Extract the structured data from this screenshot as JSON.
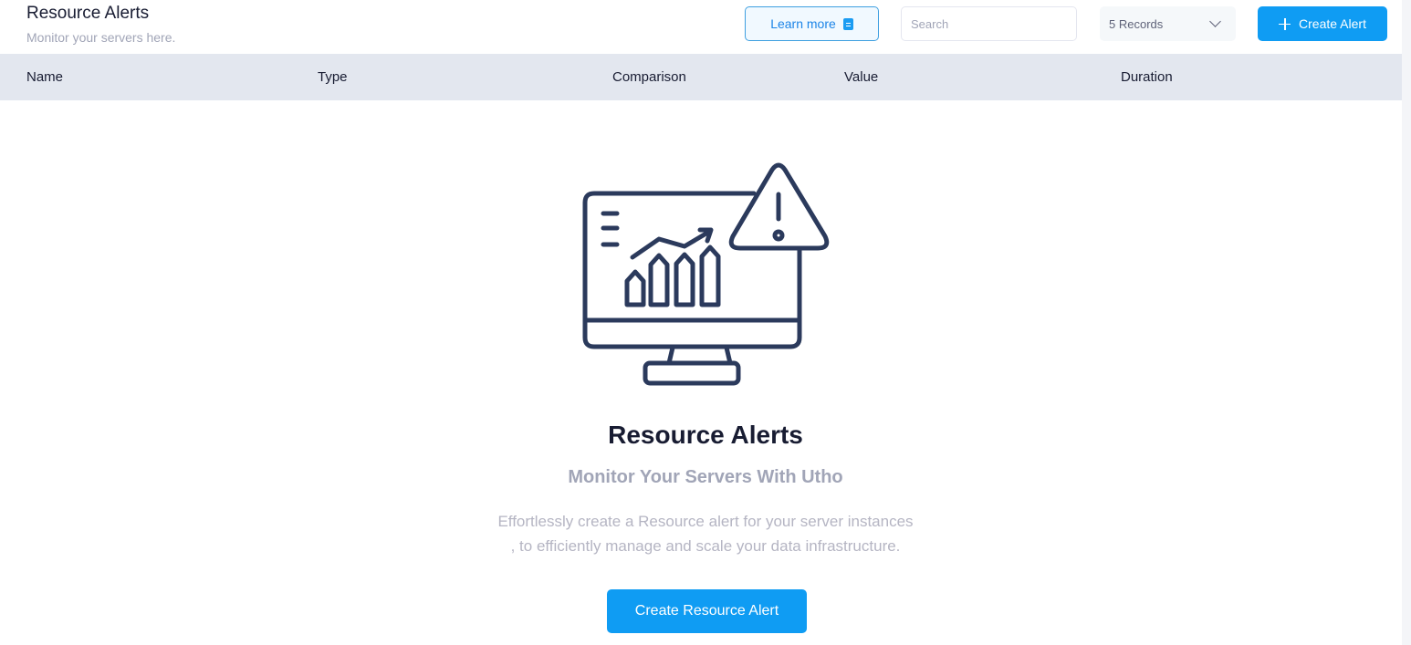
{
  "header": {
    "title": "Resource Alerts",
    "subtitle": "Monitor your servers here.",
    "learn_more_label": "Learn more",
    "search_placeholder": "Search",
    "records_label": "5 Records",
    "create_alert_label": "Create Alert"
  },
  "table": {
    "columns": [
      "Name",
      "Type",
      "Comparison",
      "Value",
      "Duration"
    ]
  },
  "empty_state": {
    "title": "Resource Alerts",
    "subtitle": "Monitor Your Servers With Utho",
    "description_line1": "Effortlessly create a Resource alert for your server instances",
    "description_line2": ", to efficiently manage and scale your data infrastructure.",
    "button_label": "Create Resource Alert"
  },
  "colors": {
    "primary": "#0f9cf3",
    "header_row_bg": "#e3e7ef",
    "illustration_stroke": "#2b3a5c"
  },
  "icons": {
    "learn_more": "document-icon",
    "create": "plus-icon",
    "records": "chevron-down-icon",
    "illustration": "monitor-alert-icon"
  }
}
